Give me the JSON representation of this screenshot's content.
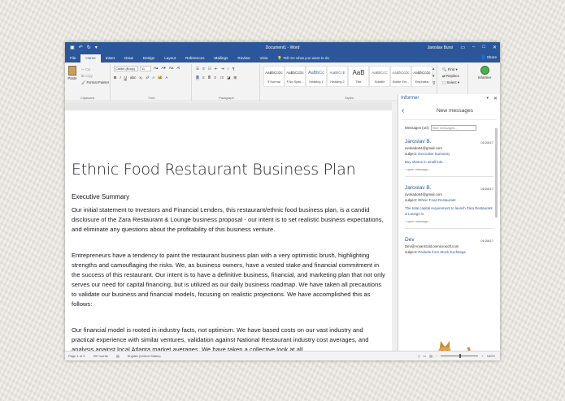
{
  "titlebar": {
    "doc_title": "Document1 - Word",
    "user": "Jaroslav Bursi"
  },
  "tabs": {
    "items": [
      "File",
      "Home",
      "Insert",
      "Draw",
      "Design",
      "Layout",
      "References",
      "Mailings",
      "Review",
      "View"
    ],
    "tell_me": "Tell me what you want to do",
    "share": "Share"
  },
  "ribbon": {
    "clipboard": {
      "label": "Clipboard",
      "paste": "Paste",
      "cut": "Cut",
      "copy": "Copy",
      "format_painter": "Format Painter"
    },
    "font": {
      "label": "Font",
      "font_name": "Calibri (Body)",
      "font_size": "11"
    },
    "paragraph": {
      "label": "Paragraph"
    },
    "styles": {
      "label": "Styles",
      "items": [
        {
          "sample": "AaBbCcDc",
          "name": "¶ Normal"
        },
        {
          "sample": "AaBbCcDc",
          "name": "¶ No Spac..."
        },
        {
          "sample": "AaBbCc",
          "name": "Heading 1"
        },
        {
          "sample": "AaBbCcE",
          "name": "Heading 2"
        },
        {
          "sample": "AaB",
          "name": "Title"
        },
        {
          "sample": "AaBbCcC",
          "name": "Subtitle"
        },
        {
          "sample": "AaBbCcDc",
          "name": "Subtle Em..."
        },
        {
          "sample": "AaBbCcDc",
          "name": "Emphasis"
        }
      ]
    },
    "editing": {
      "label": "Editing",
      "find": "Find",
      "replace": "Replace",
      "select": "Select"
    },
    "comments": {
      "label": "Comments",
      "informer": "Informer"
    }
  },
  "document": {
    "title": "Ethnic Food Restaurant Business Plan",
    "heading": "Executive Summary",
    "paragraphs": [
      "Our initial statement to Investors and Financial Lenders, this restaurant/ethnic food business plan, is a candid disclosure of the Zara Restaurant & Lounge business proposal - our intent is to set realistic business expectations, and eliminate any questions about the profitability of this business venture.",
      "Entrepreneurs have a tendency to paint the restaurant business plan with a very optimistic brush, highlighting strengths and camouflaging the risks. We, as business owners, have a vested stake and financial commitment in the success of this restaurant. Our intent is to have a definitive business, financial, and marketing plan that not only serves our need for capital financing, but is utilized as our daily business roadmap. We have taken all precautions to validate our business and financial models, focusing on realistic projections. We have accomplished this as follows:",
      "Our financial model is rooted in industry facts, not optimism. We have based costs on our vast industry and practical experience with similar ventures, validation against National Restaurant industry cost averages, and analysis against local Atlanta market averages. We have taken a collective look at all"
    ]
  },
  "informer": {
    "pane_title": "Informer",
    "header": "New messages",
    "messages_label": "Messages (10):",
    "filter_placeholder": "filter messages...",
    "messages": [
      {
        "from": "Jaroslav B.",
        "date": "01/28/17",
        "addr": "avokado64@gmail.com",
        "subject_label": "subject:",
        "subject": "Executive Summary",
        "preview": "Buy shares in small lots.",
        "open": "› open message..."
      },
      {
        "from": "Jaroslav B.",
        "date": "01/28/17",
        "addr": "avokado64@gmail.com",
        "subject_label": "subject:",
        "subject": "Ethnic Food Restaurant",
        "preview": "The total capital requirement to launch Zara Restaurant & Lounge is",
        "open": "› open message..."
      },
      {
        "from": "Dev",
        "date": "01/28/17",
        "addr": "Dev@AryanGold.onmicrosoft.com",
        "subject_label": "subject:",
        "subject": "Packets from Stock Exchange",
        "preview": "",
        "open": ""
      }
    ]
  },
  "status": {
    "page": "Page 1 of 2",
    "words": "397 words",
    "language": "English (United States)",
    "zoom": "160%"
  },
  "colors": {
    "accent": "#2b579a",
    "ribbon_bg": "#f3f3f3"
  }
}
